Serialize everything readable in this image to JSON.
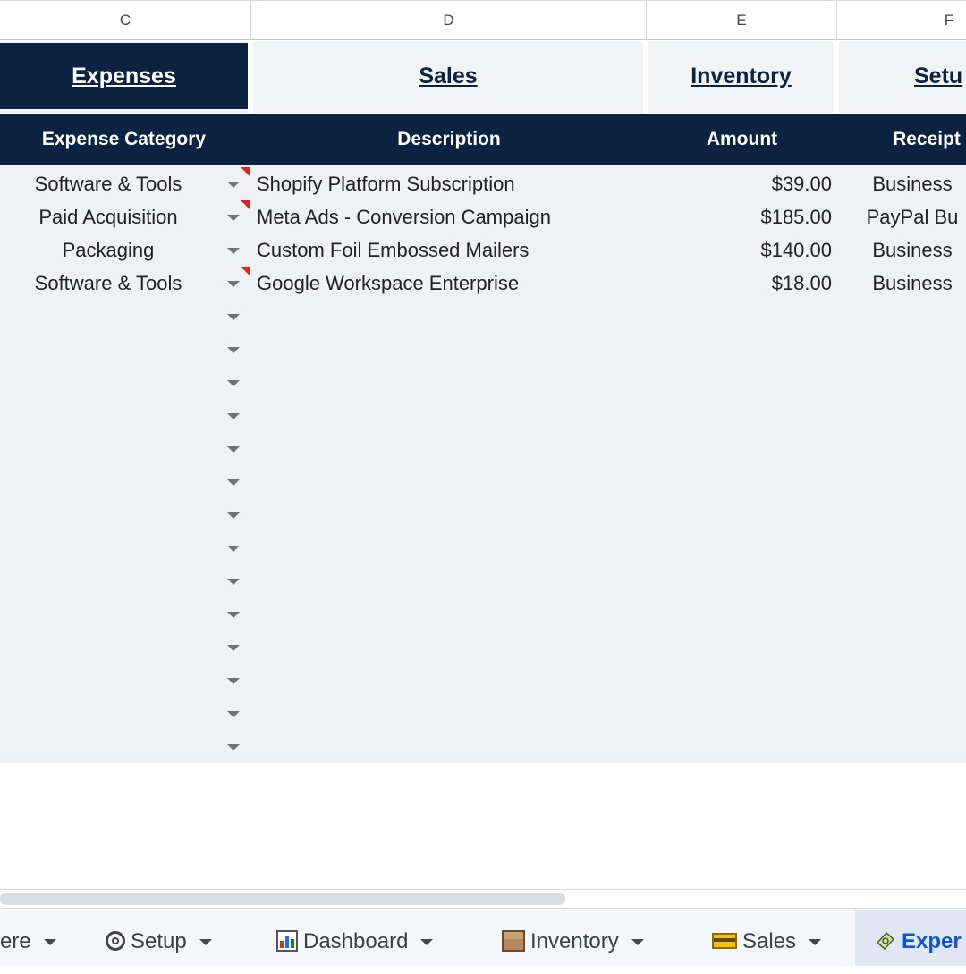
{
  "columns": [
    "C",
    "D",
    "E",
    "F"
  ],
  "nav": [
    {
      "label": "Expenses",
      "active": true
    },
    {
      "label": "Sales",
      "active": false
    },
    {
      "label": "Inventory",
      "active": false
    },
    {
      "label": "Setu",
      "active": false
    }
  ],
  "table": {
    "headers": [
      "Expense Category",
      "Description",
      "Amount",
      "Receipt"
    ],
    "rows": [
      {
        "category": "Software & Tools",
        "description": "Shopify Platform Subscription",
        "amount": "$39.00",
        "receipt": "Business",
        "has_note": true
      },
      {
        "category": "Paid Acquisition",
        "description": "Meta Ads - Conversion Campaign",
        "amount": "$185.00",
        "receipt": "PayPal Bu",
        "has_note": true
      },
      {
        "category": "Packaging",
        "description": "Custom Foil Embossed Mailers",
        "amount": "$140.00",
        "receipt": "Business",
        "has_note": false
      },
      {
        "category": "Software & Tools",
        "description": "Google Workspace Enterprise",
        "amount": "$18.00",
        "receipt": "Business",
        "has_note": true
      }
    ],
    "empty_dropdown_rows": 14
  },
  "sheet_tabs": [
    {
      "label": "ere",
      "icon": "none",
      "active": false
    },
    {
      "label": "Setup",
      "icon": "gear-icon",
      "active": false
    },
    {
      "label": "Dashboard",
      "icon": "bar-chart-icon",
      "active": false
    },
    {
      "label": "Inventory",
      "icon": "package-icon",
      "active": false
    },
    {
      "label": "Sales",
      "icon": "credit-card-icon",
      "active": false
    },
    {
      "label": "Exper",
      "icon": "money-icon",
      "active": true
    }
  ],
  "colors": {
    "navy": "#0b2340",
    "body_bg": "#eff1f4",
    "note_red": "#d9271e",
    "active_tab_text": "#0b57d0"
  }
}
